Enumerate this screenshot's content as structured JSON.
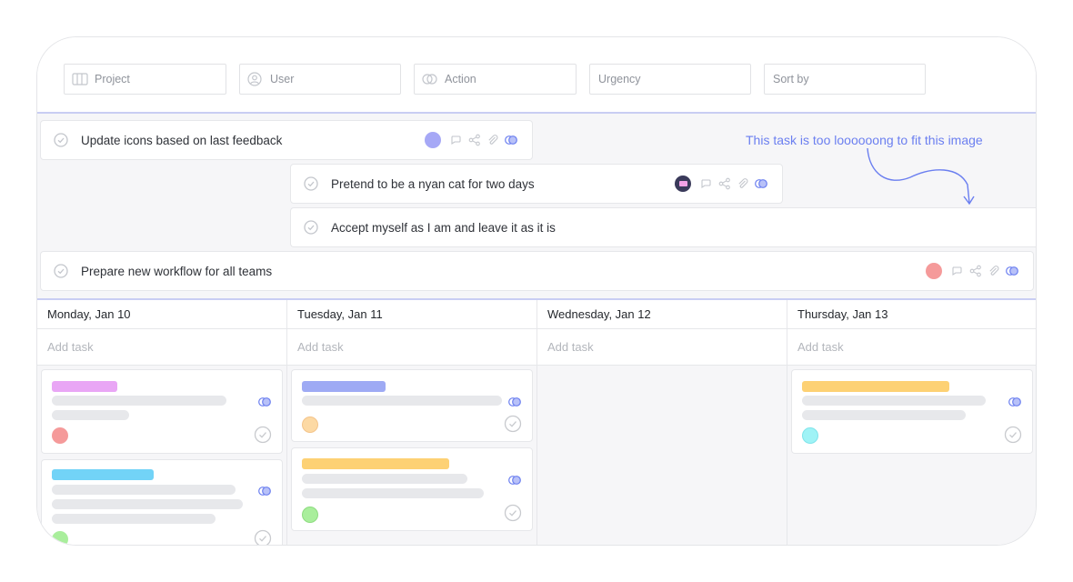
{
  "filters": [
    {
      "label": "Project",
      "icon": "columns-icon"
    },
    {
      "label": "User",
      "icon": "user-circle-icon"
    },
    {
      "label": "Action",
      "icon": "toggle-icon"
    },
    {
      "label": "Urgency",
      "icon": ""
    },
    {
      "label": "Sort by",
      "icon": ""
    }
  ],
  "timeline": {
    "tasks": [
      {
        "title": "Update icons based on last feedback",
        "avatar_color": "#a6a8f6"
      },
      {
        "title": "Pretend to be a nyan cat for two days",
        "avatar_color": "#3a3a5a"
      },
      {
        "title": "Accept myself as I am and leave it as it is"
      },
      {
        "title": "Prepare new workflow for all teams",
        "avatar_color": "#f59a9a"
      }
    ],
    "annotation": "This task is too loooooong to fit this image"
  },
  "board": {
    "add_task_label": "Add task",
    "columns": [
      {
        "day": "Monday, Jan 10"
      },
      {
        "day": "Tuesday, Jan 11"
      },
      {
        "day": "Wednesday, Jan 12"
      },
      {
        "day": "Thursday, Jan 13"
      }
    ]
  },
  "colors": {
    "accent": "#6b7ff0",
    "divider": "#c9cdf3",
    "pink": "#e9a6f5",
    "cyan": "#72d3f7",
    "blue": "#9eaaf4",
    "yellow": "#fdd174",
    "orange": "#fcd9a4",
    "red": "#f59a9a",
    "green": "#a9ee9c",
    "teal": "#9ff3f6"
  }
}
